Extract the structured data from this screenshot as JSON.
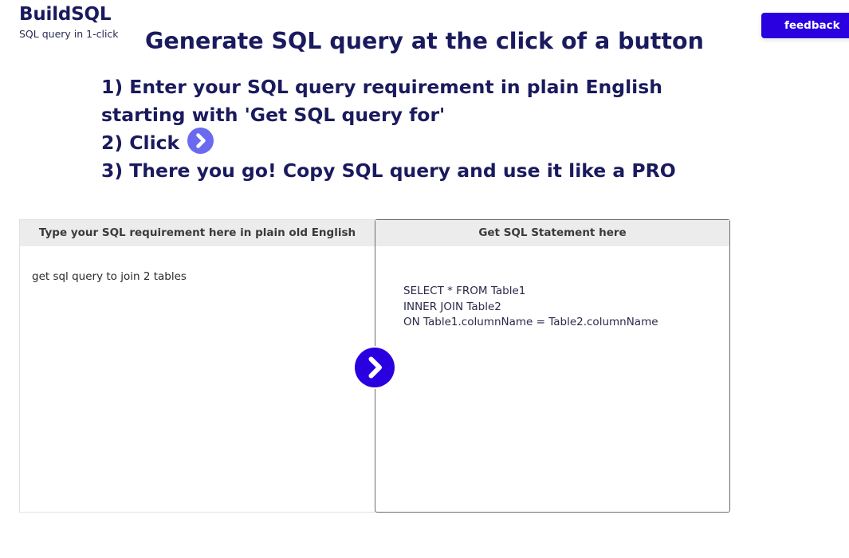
{
  "brand": {
    "name": "BuildSQL",
    "tagline": "SQL query in 1-click"
  },
  "header": {
    "feedback_label": "feedback"
  },
  "headline": "Generate SQL query at the click of a button",
  "steps": {
    "line1": "1) Enter your SQL query requirement in plain English",
    "line2": "starting with 'Get SQL query for'",
    "line3": "2) Click",
    "line4": "3) There you go! Copy SQL query and use it like a PRO"
  },
  "input_panel": {
    "header": "Type your SQL requirement here in plain old English",
    "value": "get sql query to join 2 tables"
  },
  "output_panel": {
    "header": "Get SQL Statement here",
    "lines": [
      "SELECT * FROM Table1",
      "INNER JOIN Table2",
      "ON Table1.columnName = Table2.columnName"
    ]
  },
  "icons": {
    "go": "chevron-right-circle-icon"
  },
  "colors": {
    "primary": "#2a00e0",
    "text_dark": "#1a1a5e",
    "inline_icon": "#6a6af0",
    "panel_header_bg": "#ececec"
  }
}
